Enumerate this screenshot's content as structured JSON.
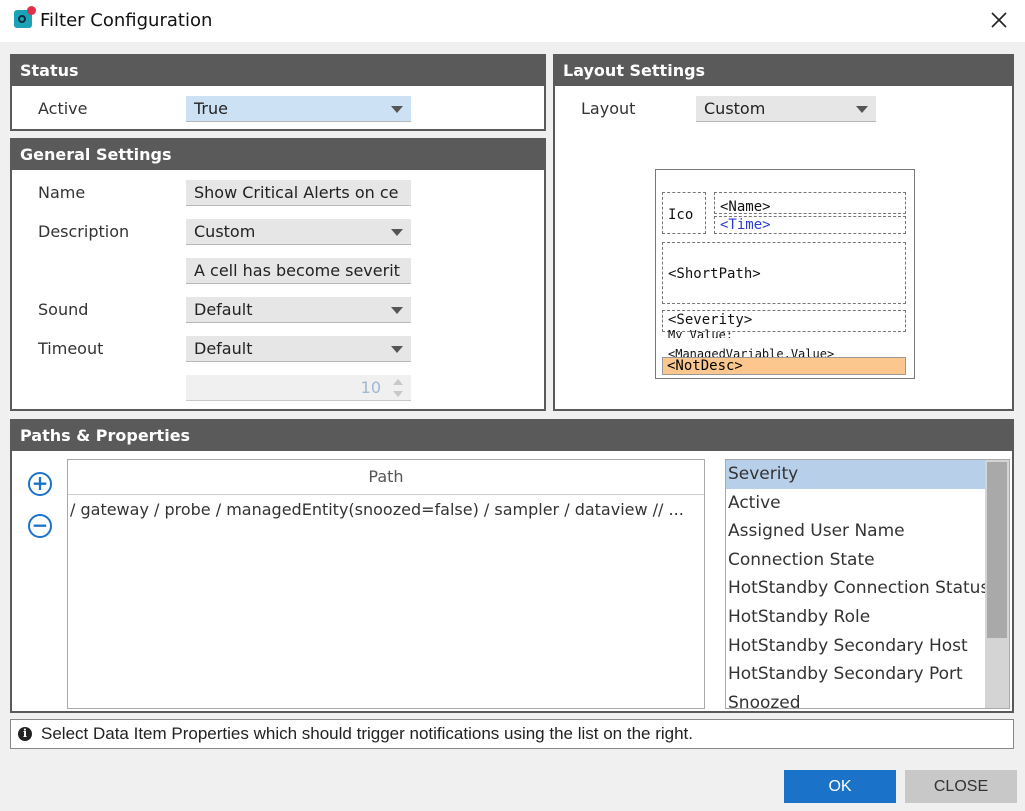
{
  "window": {
    "title": "Filter Configuration"
  },
  "status": {
    "header": "Status",
    "active_label": "Active",
    "active_value": "True"
  },
  "general": {
    "header": "General Settings",
    "name_label": "Name",
    "name_value": "Show Critical Alerts on ce",
    "description_label": "Description",
    "description_value": "Custom",
    "description_text": "A cell has become severit",
    "sound_label": "Sound",
    "sound_value": "Default",
    "timeout_label": "Timeout",
    "timeout_value": "Default",
    "timeout_number": "10"
  },
  "layout": {
    "header": "Layout Settings",
    "layout_label": "Layout",
    "layout_value": "Custom",
    "preview": {
      "ico": "Ico",
      "name": "<Name>",
      "time": "<Time>",
      "shortpath": "<ShortPath>",
      "severity": "<Severity>",
      "myvalue": "My Value:",
      "managed": "<ManagedVariable.Value>",
      "notdesc": "<NotDesc>"
    }
  },
  "paths": {
    "header": "Paths & Properties",
    "column_header": "Path",
    "rows": [
      "/ gateway / probe / managedEntity(snoozed=false) / sampler / dataview // ..."
    ],
    "properties": [
      "Severity",
      "Active",
      "Assigned User Name",
      "Connection State",
      "HotStandby Connection Status",
      "HotStandby Role",
      "HotStandby Secondary Host",
      "HotStandby Secondary Port",
      "Snoozed"
    ]
  },
  "info": {
    "text": "Select Data Item Properties which should trigger notifications using the list on the right."
  },
  "buttons": {
    "ok": "OK",
    "close": "CLOSE"
  },
  "colors": {
    "accent": "#1a73c8",
    "panel_header": "#5a5a5a",
    "notdesc_bg": "#fcc78e",
    "selection": "#b7cfe8"
  },
  "icons": {
    "add": "plus-circle-icon",
    "remove": "minus-circle-icon",
    "info": "info-icon",
    "close": "close-icon"
  }
}
